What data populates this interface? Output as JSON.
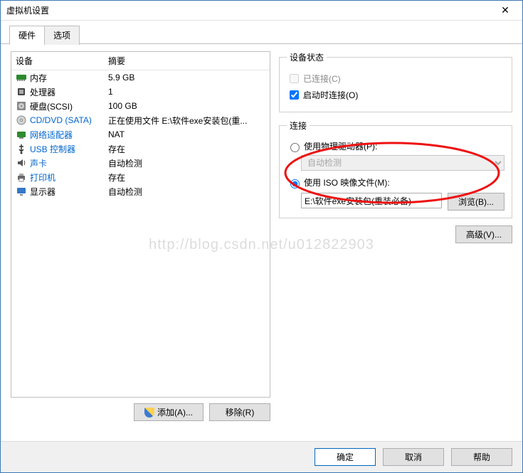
{
  "window": {
    "title": "虚拟机设置"
  },
  "tabs": {
    "hardware": "硬件",
    "options": "选项"
  },
  "hw_header": {
    "device": "设备",
    "summary": "摘要"
  },
  "hardware": [
    {
      "icon": "memory-icon",
      "name": "内存",
      "summary": "5.9 GB",
      "link": false
    },
    {
      "icon": "cpu-icon",
      "name": "处理器",
      "summary": "1",
      "link": false
    },
    {
      "icon": "disk-icon",
      "name": "硬盘(SCSI)",
      "summary": "100 GB",
      "link": false
    },
    {
      "icon": "disc-icon",
      "name": "CD/DVD (SATA)",
      "summary": "正在使用文件 E:\\软件exe安装包(重...",
      "link": true
    },
    {
      "icon": "nic-icon",
      "name": "网络适配器",
      "summary": "NAT",
      "link": true
    },
    {
      "icon": "usb-icon",
      "name": "USB 控制器",
      "summary": "存在",
      "link": true
    },
    {
      "icon": "sound-icon",
      "name": "声卡",
      "summary": "自动检测",
      "link": true
    },
    {
      "icon": "printer-icon",
      "name": "打印机",
      "summary": "存在",
      "link": true
    },
    {
      "icon": "display-icon",
      "name": "显示器",
      "summary": "自动检测",
      "link": false
    }
  ],
  "left_buttons": {
    "add": "添加(A)...",
    "remove": "移除(R)"
  },
  "device_state": {
    "legend": "设备状态",
    "connected": "已连接(C)",
    "connect_at_power_on": "启动时连接(O)"
  },
  "connection": {
    "legend": "连接",
    "use_physical": "使用物理驱动器(P):",
    "auto_detect": "自动检测",
    "use_iso": "使用 ISO 映像文件(M):",
    "iso_path": "E:\\软件exe安装包(重装必备)",
    "browse": "浏览(B)..."
  },
  "advanced": "高级(V)...",
  "footer": {
    "ok": "确定",
    "cancel": "取消",
    "help": "帮助"
  },
  "watermark": "http://blog.csdn.net/u012822903"
}
